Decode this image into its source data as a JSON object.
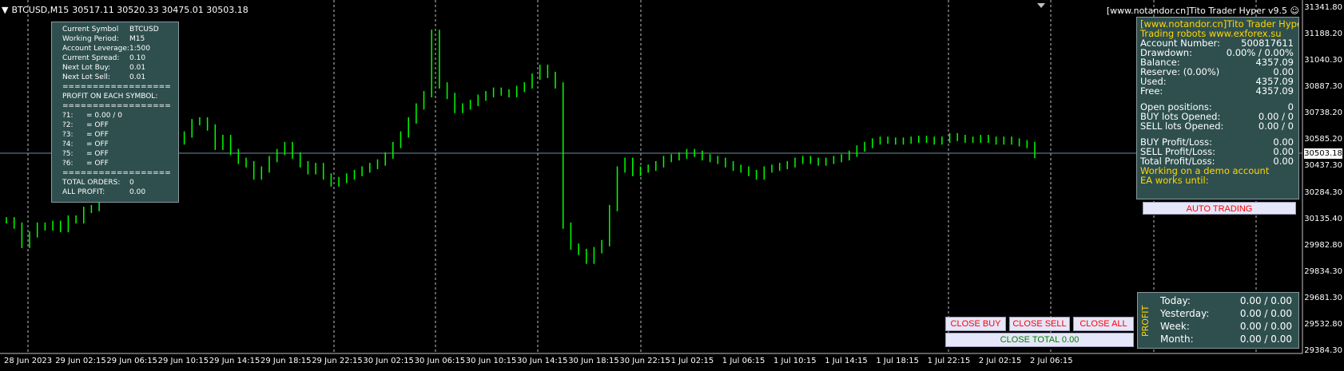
{
  "header": {
    "symbol": "BTCUSD,M15",
    "ohlc": "30517.11 30520.33 30475.01 30503.18",
    "ea_title": "[www.notandor.cn]Tito Trader Hyper v9.5"
  },
  "left_panel": {
    "rows": [
      {
        "k": "Current Symbol",
        "v": "BTCUSD"
      },
      {
        "k": "Working Period:",
        "v": "M15"
      },
      {
        "k": "Account Leverage:",
        "v": "1:500"
      },
      {
        "k": "Current Spread:",
        "v": "0.10"
      },
      {
        "k": "Next Lot Buy:",
        "v": "0.01"
      },
      {
        "k": "Next Lot Sell:",
        "v": "0.01"
      }
    ],
    "sep": "==================",
    "profit_title": "PROFIT ON EACH SYMBOL:",
    "symbols": [
      {
        "k": "?1:",
        "v": "= 0.00 / 0"
      },
      {
        "k": "?2:",
        "v": "= OFF"
      },
      {
        "k": "?3:",
        "v": "= OFF"
      },
      {
        "k": "?4:",
        "v": "= OFF"
      },
      {
        "k": "?5:",
        "v": "= OFF"
      },
      {
        "k": "?6:",
        "v": "= OFF"
      }
    ],
    "total_orders_label": "TOTAL ORDERS:",
    "total_orders": "0",
    "all_profit_label": "ALL PROFIT:",
    "all_profit": "0.00"
  },
  "right_panel": {
    "line1": "[www.notandor.cn]Tito Trader Hype",
    "line2": "Trading robots www.exforex.su",
    "account_number_label": "Account Number:",
    "account_number": "500817611",
    "drawdown_label": "Drawdown:",
    "drawdown": "0.00% / 0.00%",
    "balance_label": "Balance:",
    "balance": "4357.09",
    "reserve_label": "Reserve: (0.00%)",
    "reserve": "0.00",
    "used_label": "Used:",
    "used": "4357.09",
    "free_label": "Free:",
    "free": "4357.09",
    "open_positions_label": "Open positions:",
    "open_positions": "0",
    "buy_lots_label": "BUY lots Opened:",
    "buy_lots": "0.00 / 0",
    "sell_lots_label": "SELL lots Opened:",
    "sell_lots": "0.00 / 0",
    "buy_pl_label": "BUY Profit/Loss:",
    "buy_pl": "0.00",
    "sell_pl_label": "SELL Profit/Loss:",
    "sell_pl": "0.00",
    "total_pl_label": "Total Profit/Loss:",
    "total_pl": "0.00",
    "demo": "Working on a demo account",
    "until": "EA works until:"
  },
  "buttons": {
    "auto_trading": "AUTO TRADING",
    "close_buy": "CLOSE BUY",
    "close_sell": "CLOSE SELL",
    "close_all": "CLOSE ALL",
    "close_total": "CLOSE TOTAL 0.00"
  },
  "profit_panel": {
    "title": "PROFIT",
    "rows": [
      {
        "k": "Today:",
        "v": "0.00 / 0.00"
      },
      {
        "k": "Yesterday:",
        "v": "0.00 / 0.00"
      },
      {
        "k": "Week:",
        "v": "0.00 / 0.00"
      },
      {
        "k": "Month:",
        "v": "0.00 / 0.00"
      }
    ]
  },
  "price_axis": [
    "31341.80",
    "31188.20",
    "31040.30",
    "30887.30",
    "30738.20",
    "30585.20",
    "30437.30",
    "30284.30",
    "30135.40",
    "29982.80",
    "29834.30",
    "29681.30",
    "29532.80",
    "29384.30"
  ],
  "current_price": "30503.18",
  "time_axis": [
    "28 Jun 2023",
    "29 Jun 02:15",
    "29 Jun 06:15",
    "29 Jun 10:15",
    "29 Jun 14:15",
    "29 Jun 18:15",
    "29 Jun 22:15",
    "30 Jun 02:15",
    "30 Jun 06:15",
    "30 Jun 10:15",
    "30 Jun 14:15",
    "30 Jun 18:15",
    "30 Jun 22:15",
    "1 Jul 02:15",
    "1 Jul 06:15",
    "1 Jul 10:15",
    "1 Jul 14:15",
    "1 Jul 18:15",
    "1 Jul 22:15",
    "2 Jul 02:15",
    "2 Jul 06:15"
  ],
  "colors": {
    "candle": "#00ff00",
    "grid": "#c0c0c0",
    "panel": "#2f4f4f",
    "gold": "#ffd700"
  },
  "chart_data": {
    "type": "line",
    "title": "",
    "x_start": "28 Jun 2023",
    "interval": "M15",
    "ylim": [
      29384.3,
      31341.8
    ],
    "series": [
      {
        "values": [
          30130,
          30100,
          29990,
          30050,
          30100,
          30090,
          30110,
          30080,
          30140,
          30130,
          30190,
          30200,
          30250,
          30270,
          30350,
          30420,
          30490,
          30560,
          30620,
          30670,
          30640,
          30610,
          30580,
          30620,
          30690,
          30700,
          30660,
          30550,
          30600,
          30520,
          30470,
          30450,
          30380,
          30420,
          30480,
          30520,
          30560,
          30500,
          30450,
          30410,
          30440,
          30380,
          30340,
          30360,
          30380,
          30400,
          30420,
          30440,
          30460,
          30500,
          30560,
          30620,
          30700,
          30780,
          30850,
          31200,
          30900,
          30840,
          30760,
          30780,
          30800,
          30830,
          30850,
          30870,
          30860,
          30850,
          30880,
          30900,
          30950,
          31000,
          30960,
          30900,
          30100,
          29980,
          29950,
          29900,
          29960,
          30000,
          30200,
          30420,
          30470,
          30400,
          30420,
          30430,
          30450,
          30480,
          30490,
          30500,
          30520,
          30510,
          30490,
          30480,
          30470,
          30450,
          30430,
          30420,
          30400,
          30380,
          30420,
          30430,
          30440,
          30450,
          30470,
          30480,
          30470,
          30460,
          30470,
          30480,
          30490,
          30510,
          30540,
          30560,
          30580,
          30590,
          30585,
          30580,
          30585,
          30590,
          30595,
          30590,
          30580,
          30590,
          30610,
          30600,
          30590,
          30590,
          30600,
          30590,
          30580,
          30590,
          30580,
          30570,
          30560,
          30503.18
        ]
      }
    ]
  }
}
